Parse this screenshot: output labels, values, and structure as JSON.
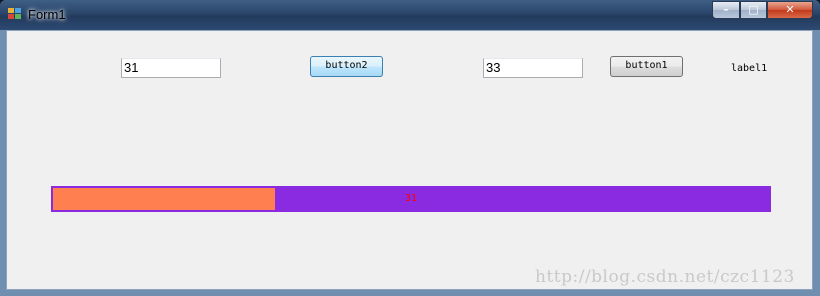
{
  "window": {
    "title": "Form1",
    "controls": {
      "minimize": "–",
      "maximize": "□",
      "close": "✕"
    }
  },
  "form": {
    "textbox1_value": "31",
    "button2_label": "button2",
    "textbox2_value": "33",
    "button1_label": "button1",
    "label1_text": "label1"
  },
  "progress": {
    "value": 31,
    "max": 100,
    "text": "31",
    "fill_color": "#ff7f50",
    "track_color": "#8a2be2",
    "text_color": "#ff0000"
  },
  "watermark": "http://blog.csdn.net/czc1123",
  "icons": [
    "app-icon",
    "minimize-icon",
    "maximize-icon",
    "close-icon"
  ]
}
